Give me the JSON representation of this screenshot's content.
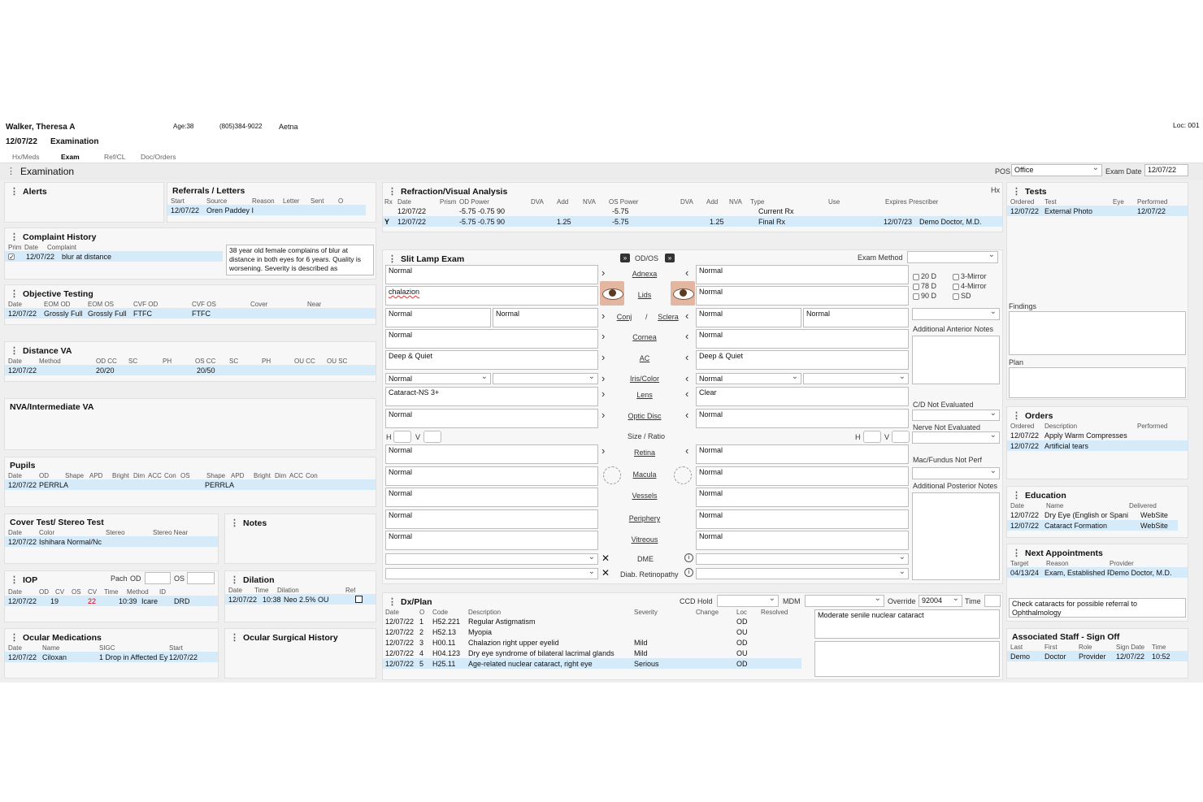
{
  "patient": {
    "name": "Walker, Theresa A",
    "age": "Age:38",
    "phone": "(805)384-9022",
    "insurance": "Aetna",
    "date": "12/07/22",
    "visit": "Examination",
    "loc": "Loc: 001"
  },
  "tabs": [
    "Hx/Meds",
    "Exam",
    "Ref/CL",
    "Doc/Orders"
  ],
  "section_title": "Examination",
  "pos": {
    "label": "POS",
    "value": "Office",
    "exam_date_label": "Exam Date",
    "exam_date": "12/07/22"
  },
  "alerts": {
    "title": "Alerts"
  },
  "referrals": {
    "title": "Referrals / Letters",
    "headers": [
      "Start",
      "Source",
      "Reason",
      "Letter",
      "Sent",
      "O"
    ],
    "rows": [
      [
        "12/07/22",
        "Oren Paddey I",
        "",
        "",
        "",
        ""
      ]
    ]
  },
  "complaint": {
    "title": "Complaint History",
    "headers": [
      "Prim",
      "Date",
      "Complaint"
    ],
    "rows": [
      [
        "12/07/22",
        "blur at distance"
      ]
    ],
    "note": "38 year old female complains of blur at distance in both eyes for 6 years. Quality is worsening. Severity is described as"
  },
  "objective": {
    "title": "Objective Testing",
    "headers": [
      "Date",
      "EOM OD",
      "EOM OS",
      "CVF OD",
      "CVF OS",
      "Cover",
      "Near"
    ],
    "rows": [
      [
        "12/07/22",
        "Grossly Full",
        "Grossly Full",
        "FTFC",
        "FTFC",
        "",
        ""
      ]
    ]
  },
  "distance": {
    "title": "Distance VA",
    "headers": [
      "Date",
      "Method",
      "OD CC",
      "SC",
      "PH",
      "OS CC",
      "SC",
      "PH",
      "OU CC",
      "OU SC"
    ],
    "rows": [
      [
        "12/07/22",
        "",
        "20/20",
        "",
        "",
        "20/50",
        "",
        "",
        "",
        ""
      ]
    ]
  },
  "nva": {
    "title": "NVA/Intermediate VA"
  },
  "pupils": {
    "title": "Pupils",
    "headers": [
      "Date",
      "OD",
      "Shape",
      "APD",
      "Bright",
      "Dim",
      "ACC",
      "Con",
      "OS",
      "Shape",
      "APD",
      "Bright",
      "Dim",
      "ACC",
      "Con"
    ],
    "rows": [
      [
        "12/07/22",
        "PERRLA",
        "",
        "",
        "",
        "",
        "",
        "",
        "PERRLA",
        "",
        "",
        "",
        "",
        "",
        ""
      ]
    ]
  },
  "cover": {
    "title": "Cover Test/ Stereo Test",
    "headers": [
      "Date",
      "Color",
      "Stereo",
      "Stereo Near"
    ],
    "rows": [
      [
        "12/07/22",
        "Ishihara Normal/Nc",
        "",
        ""
      ]
    ]
  },
  "notes": {
    "title": "Notes"
  },
  "iop": {
    "title": "IOP",
    "pach": "Pach",
    "od": "OD",
    "os": "OS",
    "headers": [
      "Date",
      "OD",
      "CV",
      "OS",
      "CV",
      "Time",
      "Method",
      "ID"
    ],
    "rows": [
      [
        "12/07/22",
        "19",
        "",
        "22",
        "",
        "10:39",
        "Icare",
        "DRD"
      ]
    ]
  },
  "dilation": {
    "title": "Dilation",
    "headers": [
      "Date",
      "Time",
      "Dilation",
      "Ref"
    ],
    "rows": [
      [
        "12/07/22",
        "10:38",
        "Neo 2.5% OU"
      ]
    ]
  },
  "ocular_meds": {
    "title": "Ocular Medications",
    "headers": [
      "Date",
      "Name",
      "SIGC",
      "Start"
    ],
    "rows": [
      [
        "12/07/22",
        "Ciloxan",
        "1 Drop in Affected Ey",
        "12/07/22"
      ]
    ]
  },
  "surgical": {
    "title": "Ocular Surgical History"
  },
  "refraction": {
    "title": "Refraction/Visual Analysis",
    "hx": "Hx",
    "headers": [
      "Rx",
      "Date",
      "Prism",
      "OD Power",
      "DVA",
      "Add",
      "NVA",
      "OS Power",
      "DVA",
      "Add",
      "NVA",
      "Type",
      "Use",
      "Expires",
      "Prescriber"
    ],
    "rows": [
      [
        "",
        "12/07/22",
        "",
        "-5.75  -0.75  90",
        "",
        "",
        "",
        "-5.75",
        "",
        "",
        "",
        "Current Rx",
        "",
        "",
        ""
      ],
      [
        "Y",
        "12/07/22",
        "",
        "-5.75  -0.75  90",
        "",
        "1.25",
        "",
        "-5.75",
        "",
        "1.25",
        "",
        "Final Rx",
        "",
        "12/07/23",
        "Demo Doctor, M.D."
      ]
    ]
  },
  "slitlamp": {
    "title": "Slit Lamp Exam",
    "odos": "OD/OS",
    "method_label": "Exam Method",
    "od": [
      "Normal",
      "chalazion",
      "Normal",
      "Normal",
      "Deep & Quiet",
      "Normal",
      "Cataract-NS 3+",
      "Normal"
    ],
    "conj_sclera_od": "Normal",
    "os": [
      "Normal",
      "Normal",
      "Normal",
      "Normal",
      "Deep & Quiet",
      "Normal",
      "Clear",
      "Normal"
    ],
    "conj_sclera_os": "Normal",
    "labels": [
      "Adnexa",
      "Lids",
      "Conj",
      "Sclera",
      "Cornea",
      "AC",
      "Iris/Color",
      "Lens",
      "Optic Disc"
    ],
    "slash": "/",
    "size_ratio": "Size / Ratio",
    "h": "H",
    "v": "V",
    "post_labels": [
      "Retina",
      "Macula",
      "Vessels",
      "Periphery",
      "Vitreous"
    ],
    "post_od": [
      "Normal",
      "Normal",
      "Normal",
      "Normal",
      "Normal"
    ],
    "post_os": [
      "Normal",
      "Normal",
      "Normal",
      "Normal",
      "Normal"
    ],
    "dme": "DME",
    "diab": "Diab. Retinopathy",
    "lens_opts": [
      "20 D",
      "78 D",
      "90 D",
      "3-Mirror",
      "4-Mirror",
      "SD"
    ],
    "add_ant": "Additional Anterior Notes",
    "cd": "C/D Not Evaluated",
    "nerve": "Nerve Not Evaluated",
    "mac": "Mac/Fundus Not Perf",
    "add_post": "Additional Posterior Notes"
  },
  "dxplan": {
    "title": "Dx/Plan",
    "ccd": "CCD Hold",
    "mdm": "MDM",
    "override": "Override",
    "override_val": "92004",
    "time": "Time",
    "headers": [
      "Date",
      "O",
      "Code",
      "Description",
      "Severity",
      "Change",
      "Loc",
      "Resolved"
    ],
    "rows": [
      [
        "12/07/22",
        "1",
        "H52.221",
        "Regular Astigmatism",
        "",
        "",
        "OD",
        ""
      ],
      [
        "12/07/22",
        "2",
        "H52.13",
        "Myopia",
        "",
        "",
        "OU",
        ""
      ],
      [
        "12/07/22",
        "3",
        "H00.11",
        "Chalazion right upper eyelid",
        "Mild",
        "",
        "OD",
        ""
      ],
      [
        "12/07/22",
        "4",
        "H04.123",
        "Dry eye syndrome of bilateral lacrimal glands",
        "Mild",
        "",
        "OU",
        ""
      ],
      [
        "12/07/22",
        "5",
        "H25.11",
        "Age-related nuclear cataract, right eye",
        "Serious",
        "",
        "OD",
        ""
      ]
    ],
    "note": "Moderate senile nuclear cataract"
  },
  "tests": {
    "title": "Tests",
    "headers": [
      "Ordered",
      "Test",
      "Eye",
      "Performed"
    ],
    "rows": [
      [
        "12/07/22",
        "External Photo",
        "",
        "12/07/22"
      ]
    ],
    "findings": "Findings",
    "plan": "Plan"
  },
  "orders": {
    "title": "Orders",
    "headers": [
      "Ordered",
      "Description",
      "Performed"
    ],
    "rows": [
      [
        "12/07/22",
        "Apply Warm Compresses",
        ""
      ],
      [
        "12/07/22",
        "Artificial tears",
        ""
      ]
    ]
  },
  "education": {
    "title": "Education",
    "headers": [
      "Date",
      "Name",
      "Delivered"
    ],
    "rows": [
      [
        "12/07/22",
        "Dry Eye (English or Spani",
        "WebSite"
      ],
      [
        "12/07/22",
        "Cataract Formation",
        "WebSite"
      ]
    ]
  },
  "appointments": {
    "title": "Next Appointments",
    "headers": [
      "Target",
      "Reason",
      "Provider"
    ],
    "rows": [
      [
        "04/13/24",
        "Exam, Established Pat",
        "Demo Doctor, M.D."
      ]
    ],
    "note": "Check cataracts for possible referral to Ophthalmology"
  },
  "staff": {
    "title": "Associated Staff - Sign Off",
    "headers": [
      "Last",
      "First",
      "Role",
      "Sign Date",
      "Time"
    ],
    "rows": [
      [
        "Demo",
        "Doctor",
        "Provider",
        "12/07/22",
        "10:52"
      ]
    ]
  }
}
